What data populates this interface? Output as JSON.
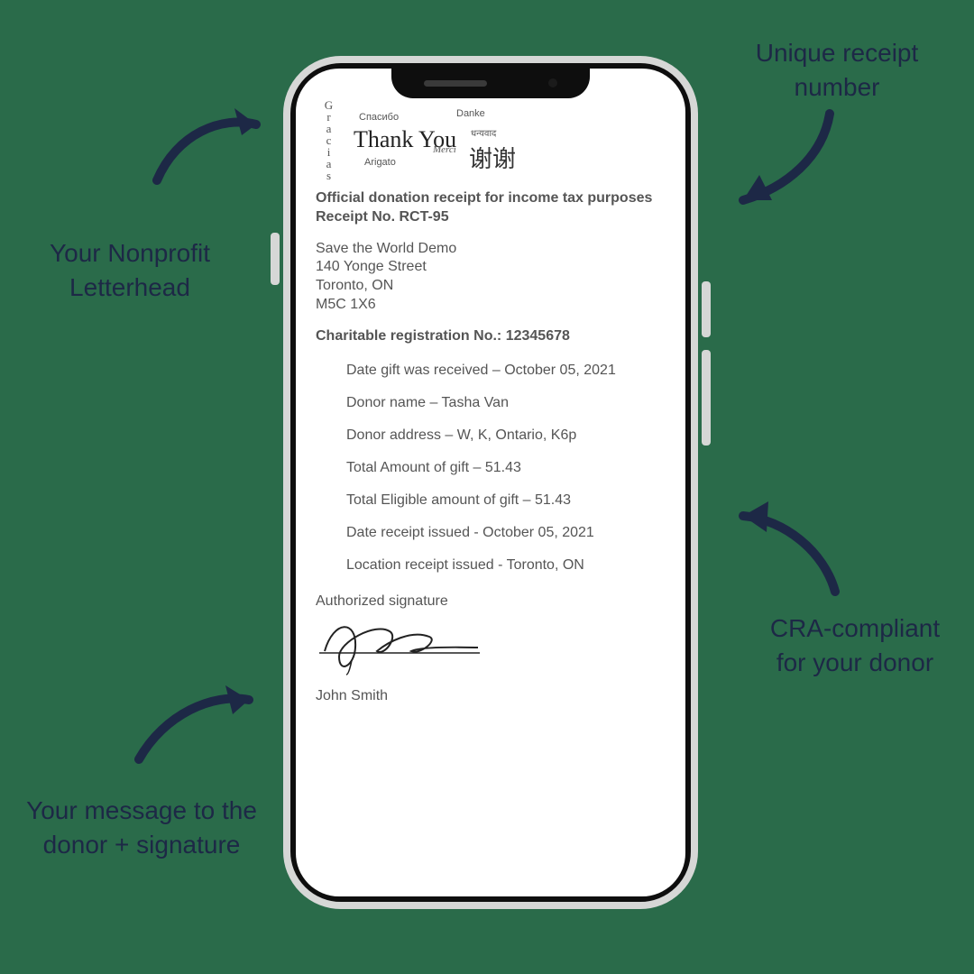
{
  "annotations": {
    "letterhead": "Your Nonprofit\nLetterhead",
    "receipt_number": "Unique receipt\nnumber",
    "cra": "CRA-compliant\nfor your donor",
    "signature": "Your message to the\ndonor + signature"
  },
  "letterhead": {
    "main": "Thank You",
    "spasibo": "Спасибо",
    "danke": "Danke",
    "hindi": "धन्यवाद",
    "merci": "Merci",
    "arigato": "Arigato",
    "gracias": "Gracias",
    "xiexie": "谢谢"
  },
  "receipt": {
    "title": "Official donation receipt for income tax purposes",
    "receipt_no_label": "Receipt No. RCT-95",
    "org_name": "Save the World Demo",
    "addr1": "140 Yonge Street",
    "addr2": "Toronto, ON",
    "addr3": "M5C 1X6",
    "reg_no": "Charitable registration No.: 12345678",
    "details": {
      "date_received": "Date gift was received – October 05, 2021",
      "donor_name": "Donor name – Tasha Van",
      "donor_address": "Donor address – W, K, Ontario, K6p",
      "total_amount": "Total Amount of gift – 51.43",
      "eligible_amount": "Total Eligible amount of gift – 51.43",
      "date_issued": "Date receipt issued - October 05, 2021",
      "location_issued": "Location receipt issued - Toronto, ON"
    },
    "auth_label": "Authorized signature",
    "signer": "John Smith"
  }
}
